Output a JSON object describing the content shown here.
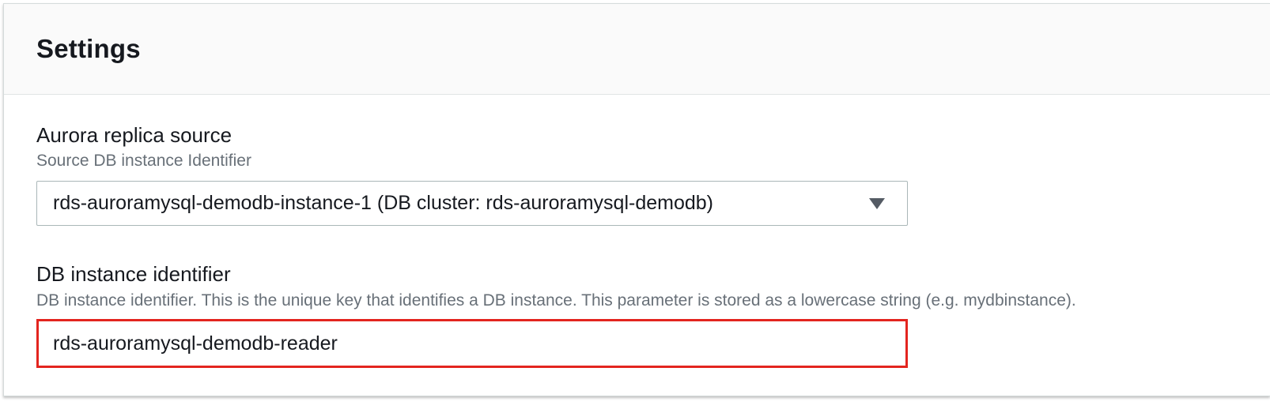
{
  "settings": {
    "title": "Settings"
  },
  "replica_source": {
    "label": "Aurora replica source",
    "description": "Source DB instance Identifier",
    "selected_value": "rds-auroramysql-demodb-instance-1 (DB cluster: rds-auroramysql-demodb)"
  },
  "db_identifier": {
    "label": "DB instance identifier",
    "description": "DB instance identifier. This is the unique key that identifies a DB instance. This parameter is stored as a lowercase string (e.g. mydbinstance).",
    "value": "rds-auroramysql-demodb-reader"
  },
  "colors": {
    "highlight_border": "#e3251f",
    "description_text": "#687078",
    "primary_text": "#16191f"
  },
  "icons": {
    "select_caret": "caret-down-icon"
  }
}
